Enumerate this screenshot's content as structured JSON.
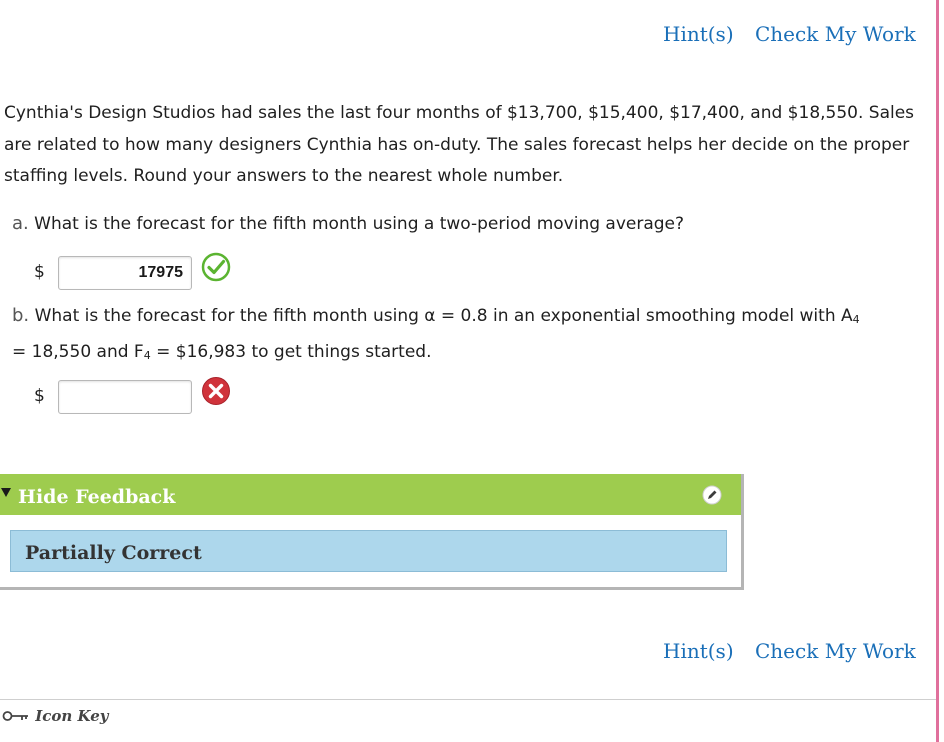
{
  "colors": {
    "link": "#1a6fb8",
    "feedback_header_bg": "#9ecc4e",
    "result_bg": "#add7ec",
    "correct_green": "#5bb431",
    "incorrect_red": "#d0333b",
    "pink_edge": "#e0709c"
  },
  "top_links": {
    "hints": "Hint(s)",
    "check_my_work": "Check My Work"
  },
  "problem": {
    "text": "Cynthia's Design Studios had sales the last four months of $13,700, $15,400, $17,400, and $18,550. Sales are related to how many designers Cynthia has on-duty. The sales forecast helps her decide on the proper staffing levels. Round your answers to the nearest whole number."
  },
  "question_a": {
    "letter": "a.",
    "text": "What is the forecast for the fifth month using a two-period moving average?",
    "currency": "$",
    "answer": "17975",
    "status_icon": "check-circle-icon"
  },
  "question_b": {
    "letter": "b.",
    "text_part1": "What is the forecast for the fifth month using α = 0.8 in an exponential smoothing model with A",
    "sub1": "4",
    "text_part2": " = 18,550 and F",
    "sub2": "4",
    "text_part3": " = $16,983 to get things started.",
    "currency": "$",
    "answer": "",
    "status_icon": "x-circle-icon"
  },
  "feedback": {
    "title": "Hide Feedback",
    "result": "Partially Correct",
    "icon": "pencil-icon"
  },
  "bottom_links": {
    "hints": "Hint(s)",
    "check_my_work": "Check My Work"
  },
  "footer": {
    "icon_key": "Icon Key"
  }
}
